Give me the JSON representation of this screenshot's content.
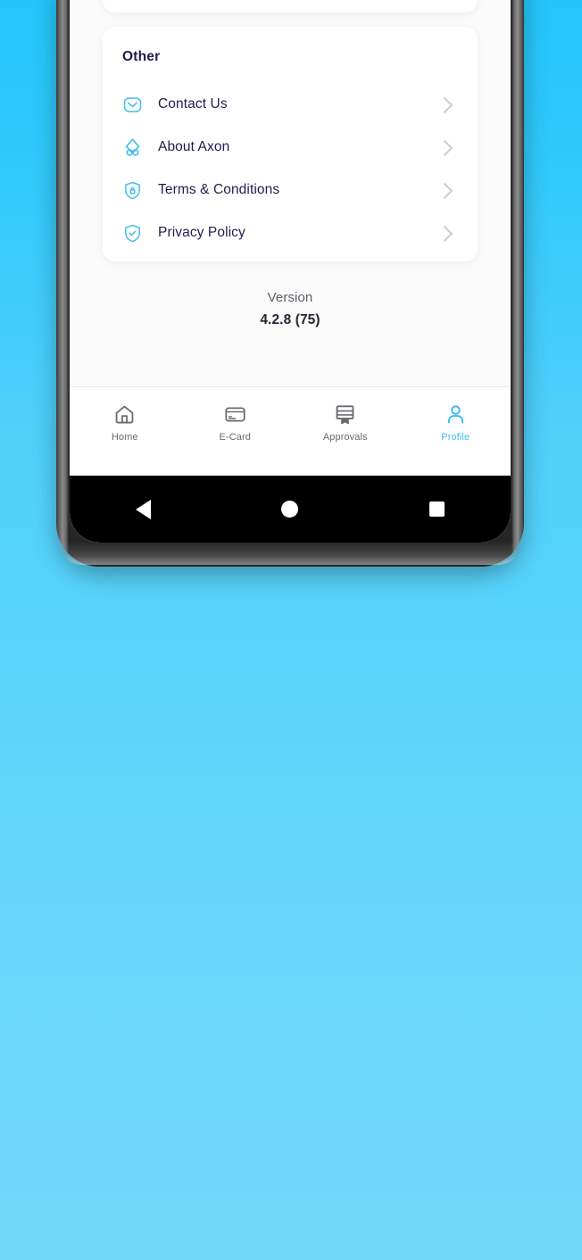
{
  "screen": {
    "app_name": "Axon",
    "partial_row_above": {
      "label": "",
      "icon": "globe-icon"
    }
  },
  "other_section": {
    "title": "Other",
    "items": [
      {
        "label": "Contact Us",
        "icon": "envelope-icon",
        "chevron": "chevron-right-icon"
      },
      {
        "label": "About Axon",
        "icon": "axon-logo-icon",
        "chevron": "chevron-right-icon"
      },
      {
        "label": "Terms & Conditions",
        "icon": "shield-lock-icon",
        "chevron": "chevron-right-icon"
      },
      {
        "label": "Privacy Policy",
        "icon": "shield-check-icon",
        "chevron": "chevron-right-icon"
      }
    ]
  },
  "version": {
    "label": "Version",
    "value": "4.2.8 (75)"
  },
  "tabbar": {
    "tabs": [
      {
        "label": "Home",
        "icon": "home-icon",
        "active": false
      },
      {
        "label": "E-Card",
        "icon": "credit-card-icon",
        "active": false
      },
      {
        "label": "Approvals",
        "icon": "certificate-icon",
        "active": false
      },
      {
        "label": "Profile",
        "icon": "person-icon",
        "active": true
      }
    ],
    "active_color": "#3fbdf0",
    "inactive_color": "#6a6a70"
  },
  "android_nav": {
    "back": "back-triangle-icon",
    "home": "home-circle-icon",
    "recents": "recents-square-icon"
  },
  "colors": {
    "accent": "#3fbdf0",
    "icon_blue": "#41bdec",
    "text_dark": "#221c4f",
    "chevron_gray": "#cbcbd3",
    "page_bg": "#fafafb",
    "card_bg": "#ffffff",
    "wallpaper_top": "#23c6fb",
    "wallpaper_bottom": "#72d9fa"
  }
}
